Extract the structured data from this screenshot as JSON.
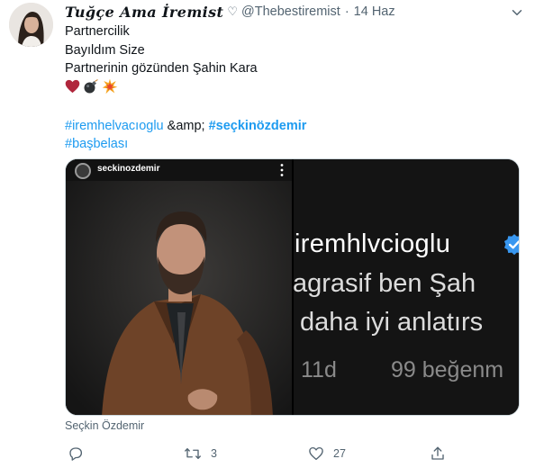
{
  "tweet": {
    "author": {
      "display_name": "Tuğçe Ama İremist",
      "name_symbol": "♡",
      "handle": "@Thebestiremist",
      "separator": "·",
      "timestamp": "14 Haz"
    },
    "lines": [
      "Partnercilik",
      "Bayıldım Size",
      "Partnerinin gözünden Şahin Kara"
    ],
    "emojis": [
      "heart-emoji",
      "bomb-emoji",
      "collision-emoji"
    ],
    "hashtag_line1": {
      "tag1": "#iremhelvacıoglu",
      "middle": " &amp; ",
      "tag2": "#seçkinözdemir"
    },
    "hashtag_line2": "#başbelası",
    "media": {
      "left_image": {
        "ig_username": "seckinozdemir"
      },
      "right_image": {
        "username": "iremhlvcioglu",
        "line2": "agrasif ben Şah",
        "line3": "daha iyi anlatırs",
        "time": "11d",
        "likes": "99 beğenm"
      }
    },
    "caption": "Seçkin Özdemir",
    "actions": {
      "reply_count": "",
      "retweet_count": "3",
      "like_count": "27"
    }
  }
}
